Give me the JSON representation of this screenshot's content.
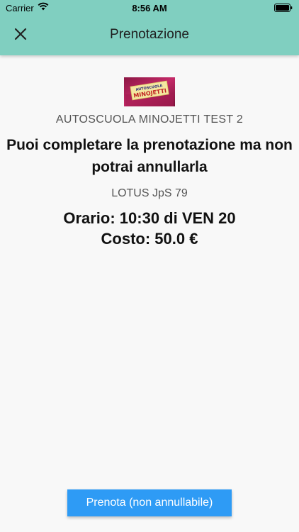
{
  "status_bar": {
    "carrier": "Carrier",
    "time": "8:56 AM",
    "wifi_icon": "wifi-icon",
    "battery_icon": "battery-icon"
  },
  "nav": {
    "title": "Prenotazione",
    "close_icon": "close-icon"
  },
  "logo": {
    "text_top": "AUTOSCUOLA",
    "text_main": "MINOJETTI"
  },
  "content": {
    "school_name": "AUTOSCUOLA MINOJETTI TEST 2",
    "headline": "Puoi completare la prenotazione ma non potrai annullarla",
    "vehicle": "LOTUS JpS 79",
    "schedule": "Orario: 10:30 di VEN 20",
    "cost": "Costo: 50.0 €"
  },
  "actions": {
    "book_label": "Prenota (non annullabile)"
  },
  "colors": {
    "header": "#80cfc0",
    "button": "#2e9bf5",
    "background": "#f8f8f8"
  }
}
